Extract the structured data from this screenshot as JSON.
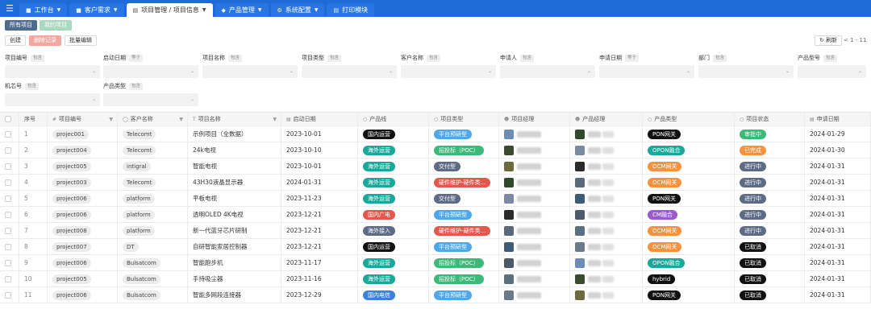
{
  "nav": {
    "menu_icon": "hamburger-icon",
    "tabs": [
      {
        "label": "工作台",
        "chevron": true
      },
      {
        "label": "客户需求",
        "chevron": true
      },
      {
        "label": "项目管理 / 项目信息",
        "chevron": true
      },
      {
        "label": "产品管理",
        "chevron": true
      },
      {
        "label": "系统配置",
        "chevron": true
      },
      {
        "label": "打印模块",
        "chevron": false
      }
    ]
  },
  "subtabs": [
    "所有项目",
    "我的项目"
  ],
  "toolbar": {
    "create": "创建",
    "batch_delete": "删除记录",
    "batch_edit": "批量编辑",
    "refresh": "刷新",
    "pager": "< 1 - 11"
  },
  "filters": [
    {
      "label": "项目编号",
      "op": "包含"
    },
    {
      "label": "启动日期",
      "op": "等于"
    },
    {
      "label": "项目名称",
      "op": "包含"
    },
    {
      "label": "项目类型",
      "op": "包含"
    },
    {
      "label": "客户名称",
      "op": "包含"
    },
    {
      "label": "申请人",
      "op": "包含"
    },
    {
      "label": "申请日期",
      "op": "等于"
    },
    {
      "label": "部门",
      "op": "包含"
    },
    {
      "label": "产品型号",
      "op": "包含"
    },
    {
      "label": "机芯号",
      "op": "包含"
    },
    {
      "label": "产品类型",
      "op": "包含"
    }
  ],
  "columns": [
    "序号",
    "项目编号",
    "客户名称",
    "项目名称",
    "启动日期",
    "产品线",
    "项目类型",
    "项目经理",
    "产品经理",
    "产品类型",
    "项目状态",
    "申请日期"
  ],
  "colors": {
    "black": "#111111",
    "teal": "#1aa89c",
    "red": "#e4574b",
    "blue": "#3b82d6",
    "purple": "#9b59d0",
    "orange": "#f5923e",
    "green": "#3cb878",
    "gray": "#5d6b86",
    "light-blue": "#4ea8e8"
  },
  "rows": [
    {
      "no": "1",
      "code": "projec001",
      "customer": "Telecomt",
      "name": "示例项目（全数据）",
      "start": "2023-10-01",
      "line": {
        "text": "国内运营",
        "color": "#111111"
      },
      "ptype": {
        "text": "平台预研型",
        "color": "#4ea8e8"
      },
      "ptype2": {
        "text": "PON网关",
        "color": "#111111"
      },
      "status": {
        "text": "审批中",
        "color": "#3cb878"
      },
      "apply": "2024-01-29"
    },
    {
      "no": "2",
      "code": "project004",
      "customer": "Telecomt",
      "name": "24k电视",
      "start": "2023-10-10",
      "line": {
        "text": "海外运营",
        "color": "#1aa89c"
      },
      "ptype": {
        "text": "招投标（POC）",
        "color": "#3cb878"
      },
      "ptype2": {
        "text": "OPON融合",
        "color": "#1aa89c"
      },
      "status": {
        "text": "已完成",
        "color": "#f5923e"
      },
      "apply": "2024-01-30"
    },
    {
      "no": "3",
      "code": "project005",
      "customer": "intigral",
      "name": "智能电视",
      "start": "2023-10-01",
      "line": {
        "text": "海外运营",
        "color": "#1aa89c"
      },
      "ptype": {
        "text": "交付型",
        "color": "#5d6b86"
      },
      "ptype2": {
        "text": "OCM网关",
        "color": "#f5923e"
      },
      "status": {
        "text": "进行中",
        "color": "#5d6b86"
      },
      "apply": "2024-01-31"
    },
    {
      "no": "4",
      "code": "project003",
      "customer": "Telecomt",
      "name": "43H30液晶显示器",
      "start": "2024-01-31",
      "line": {
        "text": "海外运营",
        "color": "#1aa89c"
      },
      "ptype": {
        "text": "硬件维护-硬件类...",
        "color": "#e4574b"
      },
      "ptype2": {
        "text": "OCM网关",
        "color": "#f5923e"
      },
      "status": {
        "text": "进行中",
        "color": "#5d6b86"
      },
      "apply": "2024-01-31"
    },
    {
      "no": "5",
      "code": "project006",
      "customer": "platform",
      "name": "平板电视",
      "start": "2023-11-23",
      "line": {
        "text": "海外运营",
        "color": "#1aa89c"
      },
      "ptype": {
        "text": "交付型",
        "color": "#5d6b86"
      },
      "ptype2": {
        "text": "PON网关",
        "color": "#111111"
      },
      "status": {
        "text": "进行中",
        "color": "#5d6b86"
      },
      "apply": "2024-01-31"
    },
    {
      "no": "6",
      "code": "project006",
      "customer": "platform",
      "name": "透明OLED 4K电视",
      "start": "2023-12-21",
      "line": {
        "text": "国内广电",
        "color": "#e4574b"
      },
      "ptype": {
        "text": "平台预研型",
        "color": "#4ea8e8"
      },
      "ptype2": {
        "text": "CM融合",
        "color": "#9b59d0"
      },
      "status": {
        "text": "进行中",
        "color": "#5d6b86"
      },
      "apply": "2024-01-31"
    },
    {
      "no": "7",
      "code": "project008",
      "customer": "platform",
      "name": "新一代蓝牙芯片研制",
      "start": "2023-12-21",
      "line": {
        "text": "海外接入",
        "color": "#5d6b86"
      },
      "ptype": {
        "text": "硬件维护-硬件类...",
        "color": "#e4574b"
      },
      "ptype2": {
        "text": "OCM网关",
        "color": "#f5923e"
      },
      "status": {
        "text": "进行中",
        "color": "#5d6b86"
      },
      "apply": "2024-01-31"
    },
    {
      "no": "8",
      "code": "project007",
      "customer": "DT",
      "name": "自研智能家居控制器",
      "start": "2023-12-21",
      "line": {
        "text": "国内运营",
        "color": "#111111"
      },
      "ptype": {
        "text": "平台预研型",
        "color": "#4ea8e8"
      },
      "ptype2": {
        "text": "OCM网关",
        "color": "#f5923e"
      },
      "status": {
        "text": "已取消",
        "color": "#111111"
      },
      "apply": "2024-01-31"
    },
    {
      "no": "9",
      "code": "project006",
      "customer": "Bulsatcom",
      "name": "智能跑步机",
      "start": "2023-11-17",
      "line": {
        "text": "海外运营",
        "color": "#1aa89c"
      },
      "ptype": {
        "text": "招投标（POC）",
        "color": "#3cb878"
      },
      "ptype2": {
        "text": "OPON融合",
        "color": "#1aa89c"
      },
      "status": {
        "text": "已取消",
        "color": "#111111"
      },
      "apply": "2024-01-31"
    },
    {
      "no": "10",
      "code": "project005",
      "customer": "Bulsatcom",
      "name": "手持吸尘器",
      "start": "2023-11-16",
      "line": {
        "text": "海外运营",
        "color": "#1aa89c"
      },
      "ptype": {
        "text": "招投标（POC）",
        "color": "#3cb878"
      },
      "ptype2": {
        "text": "hybrid",
        "color": "#111111"
      },
      "status": {
        "text": "已取消",
        "color": "#111111"
      },
      "apply": "2024-01-31"
    },
    {
      "no": "11",
      "code": "project006",
      "customer": "Bulsatcom",
      "name": "智能多网段连接器",
      "start": "2023-12-29",
      "line": {
        "text": "国内电信",
        "color": "#3b82d6"
      },
      "ptype": {
        "text": "平台预研型",
        "color": "#4ea8e8"
      },
      "ptype2": {
        "text": "PON网关",
        "color": "#111111"
      },
      "status": {
        "text": "已取消",
        "color": "#111111"
      },
      "apply": "2024-01-31"
    }
  ]
}
